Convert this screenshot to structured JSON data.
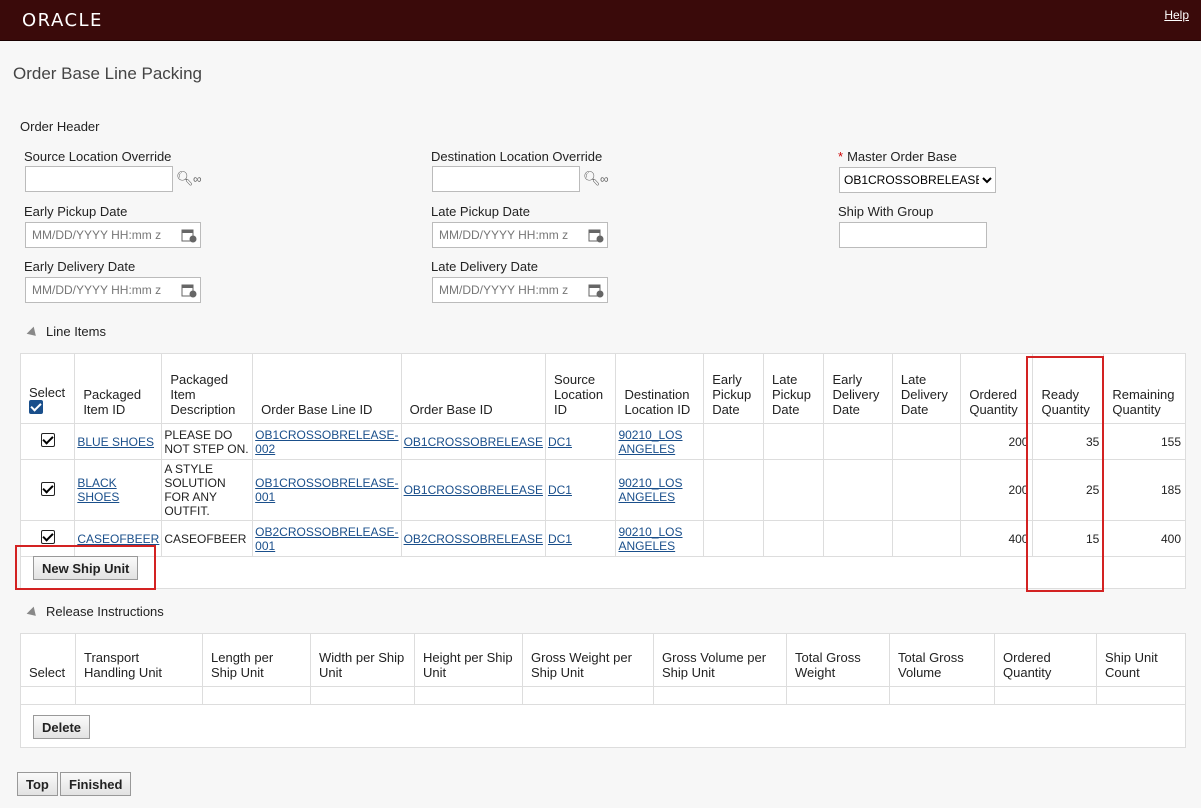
{
  "header": {
    "logo": "ORACLE",
    "help": "Help"
  },
  "page": {
    "title": "Order Base Line Packing"
  },
  "order_header": {
    "label": "Order Header",
    "source_location_override": {
      "label": "Source Location Override",
      "value": ""
    },
    "destination_location_override": {
      "label": "Destination Location Override",
      "value": ""
    },
    "master_order_base": {
      "label": "Master Order Base",
      "value": "OB1CROSSOBRELEASE"
    },
    "early_pickup_date": {
      "label": "Early Pickup Date",
      "placeholder": "MM/DD/YYYY HH:mm z"
    },
    "late_pickup_date": {
      "label": "Late Pickup Date",
      "placeholder": "MM/DD/YYYY HH:mm z"
    },
    "ship_with_group": {
      "label": "Ship With Group",
      "value": ""
    },
    "early_delivery_date": {
      "label": "Early Delivery Date",
      "placeholder": "MM/DD/YYYY HH:mm z"
    },
    "late_delivery_date": {
      "label": "Late Delivery Date",
      "placeholder": "MM/DD/YYYY HH:mm z"
    }
  },
  "line_items": {
    "label": "Line Items",
    "columns": [
      "Select",
      "Packaged Item ID",
      "Packaged Item Description",
      "Order Base Line ID",
      "Order Base ID",
      "Source Location ID",
      "Destination Location ID",
      "Early Pickup Date",
      "Late Pickup Date",
      "Early Delivery Date",
      "Late Delivery Date",
      "Ordered Quantity",
      "Ready Quantity",
      "Remaining Quantity"
    ],
    "rows": [
      {
        "item": "BLUE SHOES",
        "desc": "PLEASE DO NOT STEP ON.",
        "line_id": "OB1CROSSOBRELEASE-002",
        "base_id": "OB1CROSSOBRELEASE",
        "source": "DC1",
        "dest": "90210_LOS ANGELES",
        "ordered": "200",
        "ready": "35",
        "remaining": "155"
      },
      {
        "item": "BLACK SHOES",
        "desc": "A STYLE SOLUTION FOR ANY OUTFIT.",
        "line_id": "OB1CROSSOBRELEASE-001",
        "base_id": "OB1CROSSOBRELEASE",
        "source": "DC1",
        "dest": "90210_LOS ANGELES",
        "ordered": "200",
        "ready": "25",
        "remaining": "185"
      },
      {
        "item": "CASEOFBEER",
        "desc": "CASEOFBEER",
        "line_id": "OB2CROSSOBRELEASE-001",
        "base_id": "OB2CROSSOBRELEASE",
        "source": "DC1",
        "dest": "90210_LOS ANGELES",
        "ordered": "400",
        "ready": "15",
        "remaining": "400"
      }
    ],
    "new_ship_unit": "New Ship Unit"
  },
  "release_instructions": {
    "label": "Release Instructions",
    "columns": [
      "Select",
      "Transport Handling Unit",
      "Length per Ship Unit",
      "Width per Ship Unit",
      "Height per Ship Unit",
      "Gross Weight per Ship Unit",
      "Gross Volume per Ship Unit",
      "Total Gross Weight",
      "Total Gross Volume",
      "Ordered Quantity",
      "Ship Unit Count"
    ],
    "delete": "Delete"
  },
  "footer": {
    "top": "Top",
    "finished": "Finished"
  },
  "colors": {
    "brand_bar": "#3a0a0a",
    "link": "#1a4f8b",
    "highlight": "#d32222"
  }
}
